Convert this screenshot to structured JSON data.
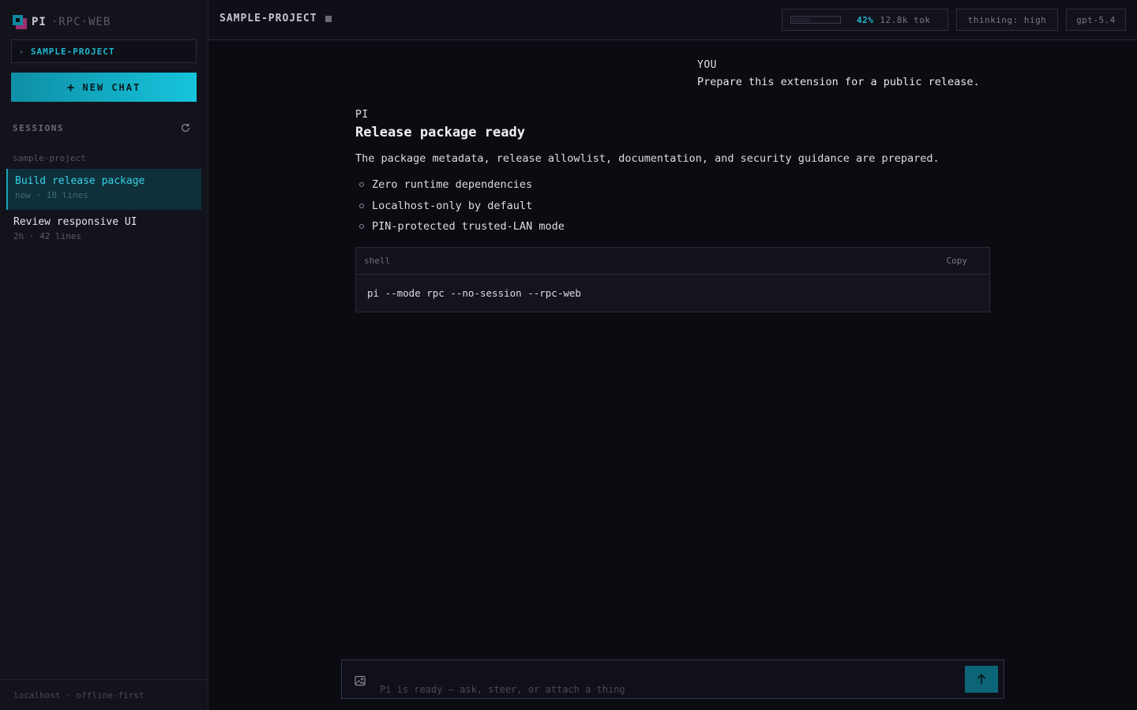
{
  "brand": {
    "pi": "PI",
    "rest": "·RPC·WEB"
  },
  "sidebar": {
    "project": "SAMPLE-PROJECT",
    "new_chat_label": "NEW CHAT",
    "sessions_label": "SESSIONS",
    "group_label": "sample-project",
    "sessions": [
      {
        "title": "Build release package",
        "meta": "now · 18 lines",
        "active": true
      },
      {
        "title": "Review responsive UI",
        "meta": "2h · 42 lines",
        "active": false
      }
    ],
    "footer": "localhost · offline-first"
  },
  "header": {
    "project_title": "SAMPLE-PROJECT",
    "context_fraction": 0.42,
    "context_percent": "42%",
    "tokens": "12.8k tok",
    "thinking": "thinking: high",
    "model": "gpt-5.4"
  },
  "chat": {
    "user": {
      "role": "YOU",
      "text": "Prepare this extension for a public release."
    },
    "assistant": {
      "role": "PI",
      "heading": "Release package ready",
      "paragraph": "The package metadata, release allowlist, documentation, and security guidance are prepared.",
      "bullets": [
        "Zero runtime dependencies",
        "Localhost-only by default",
        "PIN-protected trusted-LAN mode"
      ],
      "code": {
        "lang": "shell",
        "copy_label": "Copy",
        "content": "pi --mode rpc --no-session --rpc-web"
      }
    }
  },
  "composer": {
    "placeholder": "Pi is ready — ask, steer, or attach a thing"
  },
  "colors": {
    "accent": "#17c0d8",
    "background": "#0b0b12",
    "sidebar": "#13131c"
  }
}
